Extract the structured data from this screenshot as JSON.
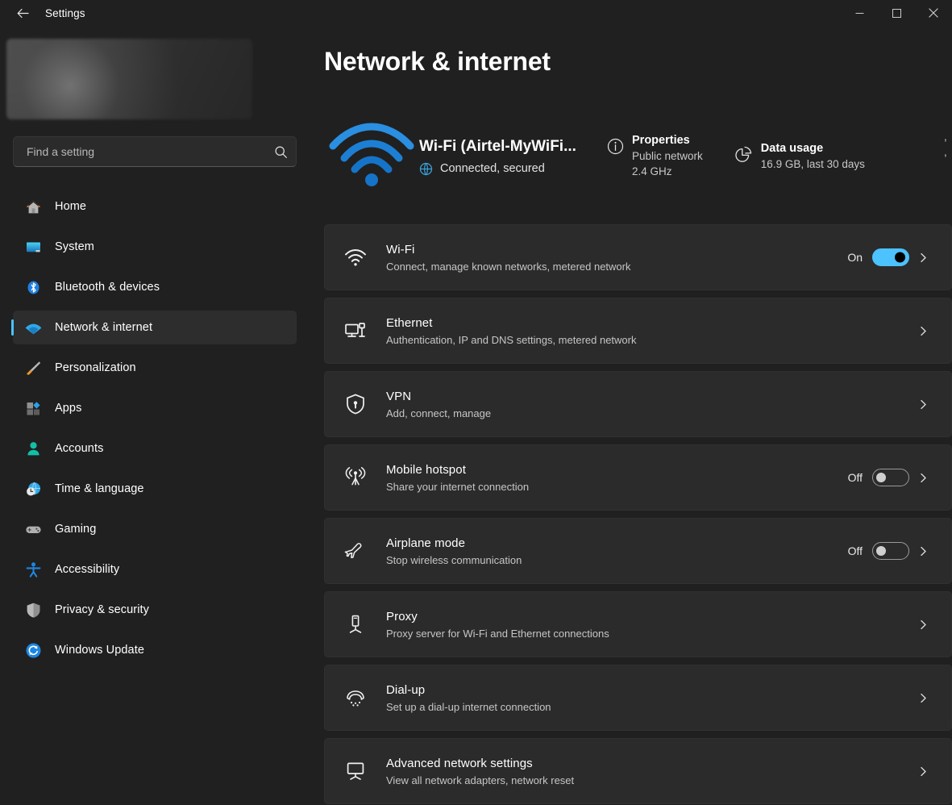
{
  "titlebar": {
    "title": "Settings",
    "back_icon": "back-arrow-icon",
    "minimize_label": "—",
    "maximize_label": "□",
    "close_label": "✕"
  },
  "sidebar": {
    "search": {
      "placeholder": "Find a setting",
      "value": ""
    },
    "items": [
      {
        "label": "Home",
        "icon": "home-icon"
      },
      {
        "label": "System",
        "icon": "system-icon"
      },
      {
        "label": "Bluetooth & devices",
        "icon": "bluetooth-icon"
      },
      {
        "label": "Network & internet",
        "icon": "wifi-icon"
      },
      {
        "label": "Personalization",
        "icon": "paintbrush-icon"
      },
      {
        "label": "Apps",
        "icon": "apps-icon"
      },
      {
        "label": "Accounts",
        "icon": "account-icon"
      },
      {
        "label": "Time & language",
        "icon": "clock-globe-icon"
      },
      {
        "label": "Gaming",
        "icon": "gamepad-icon"
      },
      {
        "label": "Accessibility",
        "icon": "accessibility-icon"
      },
      {
        "label": "Privacy & security",
        "icon": "shield-icon"
      },
      {
        "label": "Windows Update",
        "icon": "update-icon"
      }
    ],
    "selected": "Network & internet"
  },
  "main": {
    "page_title": "Network & internet",
    "status": {
      "connection_title": "Wi-Fi (Airtel-MyWiFi...",
      "connection_state": "Connected, secured",
      "tiles": [
        {
          "title": "Properties",
          "line1": "Public network",
          "line2": "2.4 GHz",
          "icon": "info-icon"
        },
        {
          "title": "Data usage",
          "line1": "16.9 GB, last 30 days",
          "line2": "",
          "icon": "pie-chart-icon"
        }
      ],
      "clipped_tile": {
        "line1": ",",
        "line2": ","
      }
    },
    "rows": [
      {
        "title": "Wi-Fi",
        "subtitle": "Connect, manage known networks, metered network",
        "icon": "wifi-icon",
        "toggle": "on",
        "toggle_label": "On"
      },
      {
        "title": "Ethernet",
        "subtitle": "Authentication, IP and DNS settings, metered network",
        "icon": "ethernet-icon",
        "toggle": "none",
        "toggle_label": ""
      },
      {
        "title": "VPN",
        "subtitle": "Add, connect, manage",
        "icon": "vpn-shield-icon",
        "toggle": "none",
        "toggle_label": ""
      },
      {
        "title": "Mobile hotspot",
        "subtitle": "Share your internet connection",
        "icon": "hotspot-icon",
        "toggle": "off",
        "toggle_label": "Off"
      },
      {
        "title": "Airplane mode",
        "subtitle": "Stop wireless communication",
        "icon": "airplane-icon",
        "toggle": "off",
        "toggle_label": "Off"
      },
      {
        "title": "Proxy",
        "subtitle": "Proxy server for Wi-Fi and Ethernet connections",
        "icon": "proxy-icon",
        "toggle": "none",
        "toggle_label": ""
      },
      {
        "title": "Dial-up",
        "subtitle": "Set up a dial-up internet connection",
        "icon": "dialup-icon",
        "toggle": "none",
        "toggle_label": ""
      },
      {
        "title": "Advanced network settings",
        "subtitle": "View all network adapters, network reset",
        "icon": "advanced-network-icon",
        "toggle": "none",
        "toggle_label": ""
      }
    ]
  },
  "colors": {
    "accent": "#4cc2ff",
    "page_bg": "#202020",
    "card_bg": "#2b2b2b",
    "text_primary": "#ffffff",
    "text_secondary": "#c6c6c6"
  }
}
